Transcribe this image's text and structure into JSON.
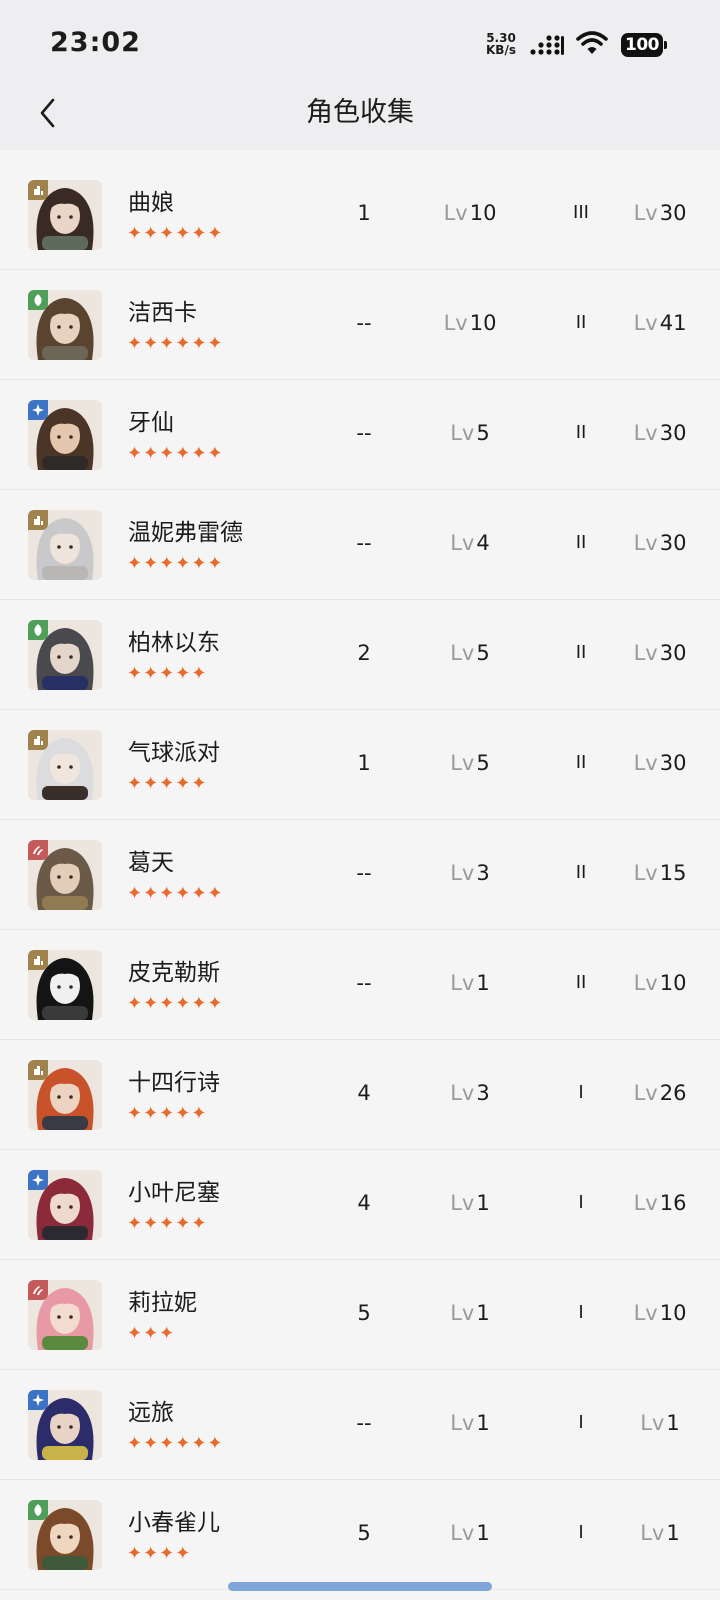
{
  "status_bar": {
    "time": "23:02",
    "net_speed_value": "5.30",
    "net_speed_unit": "KB/s",
    "battery": "100",
    "icons": [
      "signal-icon",
      "wifi-icon",
      "battery-icon"
    ]
  },
  "header": {
    "title": "角色收集",
    "back_icon": "chevron-left-icon"
  },
  "lv_prefix": "Lv",
  "colors": {
    "star": "#e86a2c",
    "element_gold": "#a0824c",
    "element_green": "#4f9e5a",
    "element_blue": "#3d73c4",
    "element_red": "#c45a5a"
  },
  "characters": [
    {
      "name": "曲娘",
      "stars": "✦✦✦✦✦✦",
      "element": "gold",
      "count": "1",
      "level": "10",
      "rank": "III",
      "level2": "30",
      "palette": [
        "#3a2a26",
        "#e9d6c8",
        "#5e6b5a"
      ]
    },
    {
      "name": "洁西卡",
      "stars": "✦✦✦✦✦✦",
      "element": "green",
      "count": "--",
      "level": "10",
      "rank": "II",
      "level2": "41",
      "palette": [
        "#5a4430",
        "#e7d2bf",
        "#6b6656"
      ]
    },
    {
      "name": "牙仙",
      "stars": "✦✦✦✦✦✦",
      "element": "blue",
      "count": "--",
      "level": "5",
      "rank": "II",
      "level2": "30",
      "palette": [
        "#4a3527",
        "#e4c7ae",
        "#2e2a28"
      ]
    },
    {
      "name": "温妮弗雷德",
      "stars": "✦✦✦✦✦✦",
      "element": "gold",
      "count": "--",
      "level": "4",
      "rank": "II",
      "level2": "30",
      "palette": [
        "#c9c9cc",
        "#efe4dc",
        "#b8b7b5"
      ]
    },
    {
      "name": "柏林以东",
      "stars": "✦✦✦✦✦",
      "element": "green",
      "count": "2",
      "level": "5",
      "rank": "II",
      "level2": "30",
      "palette": [
        "#4a4a4e",
        "#e5d6cb",
        "#263064"
      ]
    },
    {
      "name": "气球派对",
      "stars": "✦✦✦✦✦",
      "element": "gold",
      "count": "1",
      "level": "5",
      "rank": "II",
      "level2": "30",
      "palette": [
        "#dcdcdf",
        "#f1e6de",
        "#3a2e2a"
      ]
    },
    {
      "name": "葛天",
      "stars": "✦✦✦✦✦✦",
      "element": "red",
      "count": "--",
      "level": "3",
      "rank": "II",
      "level2": "15",
      "palette": [
        "#6b5a48",
        "#e2cdb9",
        "#8f7a52"
      ]
    },
    {
      "name": "皮克勒斯",
      "stars": "✦✦✦✦✦✦",
      "element": "gold",
      "count": "--",
      "level": "1",
      "rank": "II",
      "level2": "10",
      "palette": [
        "#141414",
        "#f0f0f0",
        "#3a3a3a"
      ]
    },
    {
      "name": "十四行诗",
      "stars": "✦✦✦✦✦",
      "element": "gold",
      "count": "4",
      "level": "3",
      "rank": "I",
      "level2": "26",
      "palette": [
        "#c8522a",
        "#ecd3c2",
        "#3a3a44"
      ]
    },
    {
      "name": "小叶尼塞",
      "stars": "✦✦✦✦✦",
      "element": "blue",
      "count": "4",
      "level": "1",
      "rank": "I",
      "level2": "16",
      "palette": [
        "#8a2a3a",
        "#efd8cd",
        "#2a2a30"
      ]
    },
    {
      "name": "莉拉妮",
      "stars": "✦✦✦",
      "element": "red",
      "count": "5",
      "level": "1",
      "rank": "I",
      "level2": "10",
      "palette": [
        "#e79aa6",
        "#f3dccf",
        "#5a8a3e"
      ]
    },
    {
      "name": "远旅",
      "stars": "✦✦✦✦✦✦",
      "element": "blue",
      "count": "--",
      "level": "1",
      "rank": "I",
      "level2": "1",
      "palette": [
        "#2c2c6a",
        "#e8d4c6",
        "#c9b24a"
      ]
    },
    {
      "name": "小春雀儿",
      "stars": "✦✦✦✦",
      "element": "green",
      "count": "5",
      "level": "1",
      "rank": "I",
      "level2": "1",
      "palette": [
        "#7a4a2a",
        "#efd6bf",
        "#3f5a3a"
      ]
    }
  ]
}
